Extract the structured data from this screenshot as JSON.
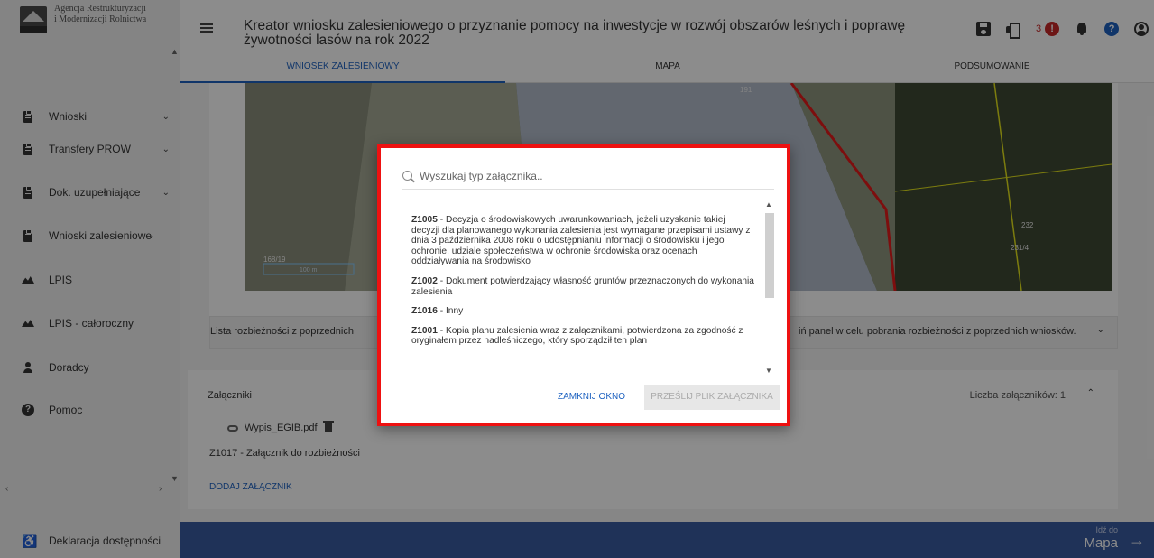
{
  "sidebar": {
    "logo_line1": "Agencja Restrukturyzacji",
    "logo_line2": "i Modernizacji Rolnictwa",
    "items": [
      {
        "label": "Wnioski",
        "icon": "document-icon"
      },
      {
        "label": "Transfery PROW",
        "icon": "document-icon"
      },
      {
        "label": "Dok. uzupełniające",
        "icon": "document-icon"
      },
      {
        "label": "Wnioski zalesieniowe",
        "icon": "document-icon"
      },
      {
        "label": "LPIS",
        "icon": "terrain-icon"
      },
      {
        "label": "LPIS - całoroczny",
        "icon": "terrain-icon"
      },
      {
        "label": "Doradcy",
        "icon": "person-icon"
      },
      {
        "label": "Pomoc",
        "icon": "help-icon"
      }
    ],
    "accessibility_label": "Deklaracja dostępności"
  },
  "header": {
    "title": "Kreator wniosku zalesieniowego o przyznanie pomocy na inwestycje w rozwój obszarów leśnych i poprawę żywotności lasów na rok 2022",
    "notification_count": "3",
    "alert_glyph": "!",
    "help_glyph": "?"
  },
  "tabs": [
    {
      "label": "WNIOSEK ZALESIENIOWY",
      "active": true
    },
    {
      "label": "MAPA",
      "active": false
    },
    {
      "label": "PODSUMOWANIE",
      "active": false
    }
  ],
  "map": {
    "labels": [
      "191",
      "232",
      "231/4",
      "168/19",
      "100 m"
    ]
  },
  "discrepancies": {
    "label": "Lista rozbieżności z poprzednich",
    "hint": "iń panel w celu pobrania rozbieżności z poprzednich wniosków."
  },
  "attachments": {
    "title": "Załączniki",
    "count_label": "Liczba załączników: 1",
    "file_name": "Wypis_EGIB.pdf",
    "file_type": "Z1017 - Załącznik do rozbieżności",
    "add_label": "DODAJ ZAŁĄCZNIK"
  },
  "footer": {
    "go_small": "Idź do",
    "go_big": "Mapa",
    "arrow": "→"
  },
  "modal": {
    "search_placeholder": "Wyszukaj typ załącznika..",
    "items": [
      {
        "code": "Z1005",
        "text": " - Decyzja o środowiskowych uwarunkowaniach, jeżeli uzyskanie takiej decyzji dla planowanego wykonania zalesienia jest wymagane przepisami ustawy z dnia 3 października 2008 roku o udostępnianiu informacji o środowisku i jego ochronie, udziale społeczeństwa w ochronie środowiska oraz ocenach oddziaływania na środowisko"
      },
      {
        "code": "Z1002",
        "text": " - Dokument potwierdzający własność gruntów przeznaczonych do wykonania zalesienia"
      },
      {
        "code": "Z1016",
        "text": " - Inny"
      },
      {
        "code": "Z1001",
        "text": " - Kopia planu zalesienia wraz z załącznikami, potwierdzona za zgodność z oryginałem przez nadleśniczego, który sporządził ten plan"
      }
    ],
    "close_label": "ZAMKNIJ OKNO",
    "send_label": "PRZEŚLIJ PLIK ZAŁĄCZNIKA"
  },
  "colors": {
    "accent": "#1e62c0",
    "footer": "#3a5ba0",
    "modal_outline": "#ee1111",
    "alert": "#c62828"
  }
}
